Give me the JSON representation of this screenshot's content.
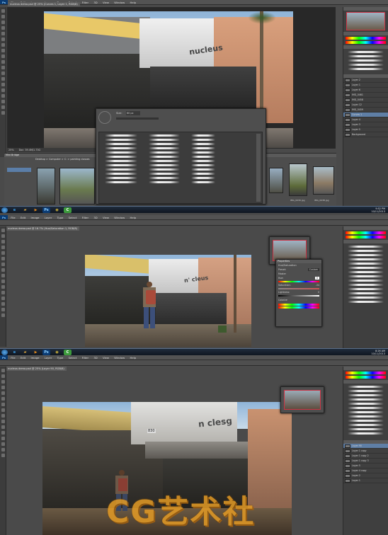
{
  "screenshots": [
    {
      "title_tab": "nucleus demo.psd @ 25% (Curves 1, Layer 1, RGB/8)",
      "menu": [
        "Ps",
        "File",
        "Edit",
        "Image",
        "Layer",
        "Type",
        "Select",
        "Filter",
        "3D",
        "View",
        "Window",
        "Help"
      ],
      "zoom": "25%",
      "doc_info": "Doc: 39.4M/1.73G",
      "sign_text": "nucleus",
      "bridge_label": "Mini Bridge",
      "bridge_path": "Desktop > Computer > C: > painting classes",
      "file_names": [
        "IMG_0020.jpg",
        "IMG_0021.jpg",
        "IMG_0030.jpg",
        "IMG_0038.jpg"
      ],
      "brush_panel": {
        "size_label": "Size:",
        "size_value": "60 px"
      },
      "layers": [
        "Layer 2",
        "Layer 1",
        "Layer 6",
        "IMG_0461",
        "IMG_0458",
        "Layer 12",
        "IMG_0459",
        "Curves 1",
        "Layer 4",
        "Layer 3",
        "Layer 5",
        "Background"
      ],
      "clock": {
        "time": "9:52 PM",
        "date": "10/11/2013"
      }
    },
    {
      "title_tab": "nucleus demo.psd @ 16.7% (Hue/Saturation 1, RGB/8)",
      "menu": [
        "Ps",
        "File",
        "Edit",
        "Image",
        "Layer",
        "Type",
        "Select",
        "Filter",
        "3D",
        "View",
        "Window",
        "Help"
      ],
      "zoom": "16.7%",
      "sign_text": "n' cleus",
      "properties_title": "Properties",
      "properties_sub": "Hue/Saturation",
      "properties_rows": [
        {
          "label": "Preset:",
          "value": "Custom"
        },
        {
          "label": "Master",
          "value": ""
        },
        {
          "label": "Hue:",
          "value": "0"
        },
        {
          "label": "Saturation:",
          "value": "-34"
        },
        {
          "label": "Lightness:",
          "value": "0"
        }
      ],
      "colorize_label": "Colorize",
      "clock": {
        "time": "8:26 AM",
        "date": "10/11/2013"
      }
    },
    {
      "title_tab": "nucleus demo.psd @ 25% (Layer 90, RGB/8)",
      "menu": [
        "Ps",
        "File",
        "Edit",
        "Image",
        "Layer",
        "Type",
        "Select",
        "Filter",
        "3D",
        "View",
        "Window",
        "Help"
      ],
      "sign_text": "n clesg",
      "address_number": "830",
      "watermark": "CG艺术社",
      "layers": [
        "Layer 90",
        "Layer 1 copy",
        "Layer 1 copy 2",
        "Layer 1 copy 3",
        "Layer 5",
        "Layer 4 copy",
        "Layer 2",
        "Layer 1"
      ]
    }
  ],
  "taskbar_icons": [
    {
      "name": "ie-icon",
      "glyph": "e",
      "color": "#1e78d6"
    },
    {
      "name": "folder-icon",
      "glyph": "▰",
      "color": "#d8a23a"
    },
    {
      "name": "media-player-icon",
      "glyph": "▶",
      "color": "#e48a1c"
    },
    {
      "name": "photoshop-icon",
      "glyph": "Ps",
      "color": "#0b3b73"
    },
    {
      "name": "chrome-icon",
      "glyph": "◉",
      "color": "#3a9a3a"
    },
    {
      "name": "camtasia-icon",
      "glyph": "C",
      "color": "#3c9a3c"
    }
  ],
  "colors": {
    "ps_dark": "#282828",
    "ps_panel": "#4a4a4a",
    "watermark_orange": "#e49b25"
  }
}
